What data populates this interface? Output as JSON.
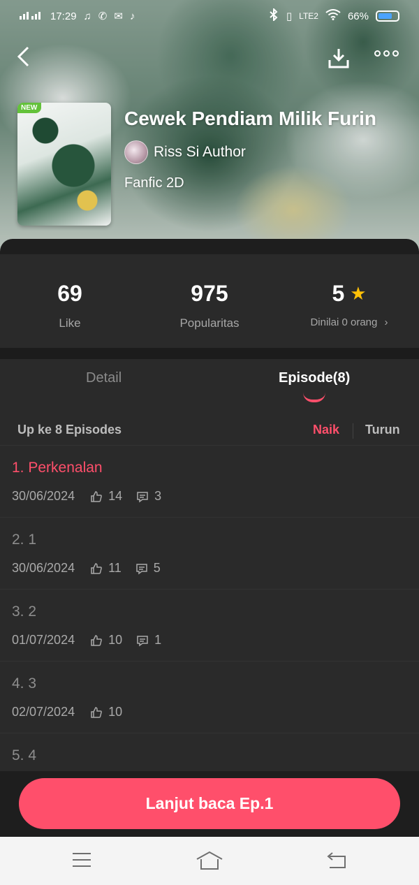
{
  "status": {
    "time": "17:29",
    "network": "LTE2",
    "battery": "66%"
  },
  "hero": {
    "badge": "NEW",
    "title": "Cewek Pendiam Milik Furin",
    "author": "Riss Si Author",
    "genre": "Fanfic 2D"
  },
  "stats": [
    {
      "value": "69",
      "label": "Like"
    },
    {
      "value": "975",
      "label": "Popularitas"
    },
    {
      "value": "5",
      "label": "Dinilai 0 orang"
    }
  ],
  "tabs": {
    "detail": "Detail",
    "episode": "Episode(8)"
  },
  "list_header": {
    "count": "Up ke 8 Episodes",
    "sort_asc": "Naik",
    "sort_desc": "Turun"
  },
  "episodes": [
    {
      "title": "1. Perkenalan",
      "date": "30/06/2024",
      "likes": "14",
      "comments": "3"
    },
    {
      "title": "2. 1",
      "date": "30/06/2024",
      "likes": "11",
      "comments": "5"
    },
    {
      "title": "3. 2",
      "date": "01/07/2024",
      "likes": "10",
      "comments": "1"
    },
    {
      "title": "4. 3",
      "date": "02/07/2024",
      "likes": "10"
    },
    {
      "title": "5. 4"
    }
  ],
  "cta": "Lanjut baca Ep.1",
  "colors": {
    "accent": "#ff4f6b",
    "star": "#ffc107",
    "panel": "#2a2a2a"
  }
}
